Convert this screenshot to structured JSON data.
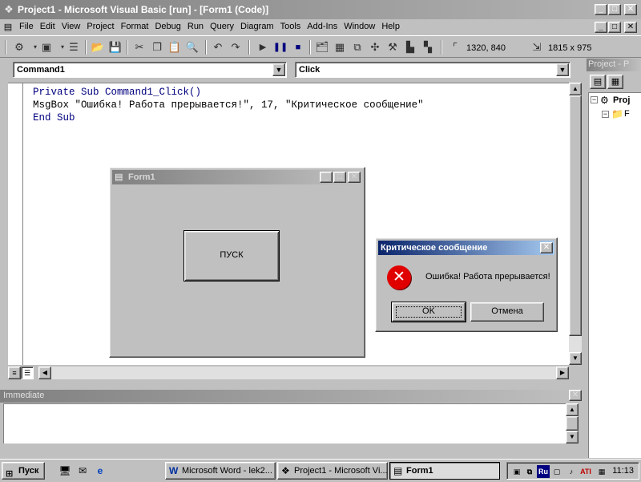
{
  "window": {
    "title": "Project1 - Microsoft Visual Basic [run] - [Form1 (Code)]",
    "min": "_",
    "max": "□",
    "close": "✕"
  },
  "menu": [
    "File",
    "Edit",
    "View",
    "Project",
    "Format",
    "Debug",
    "Run",
    "Query",
    "Diagram",
    "Tools",
    "Add-Ins",
    "Window",
    "Help"
  ],
  "toolbar": {
    "position": "1320, 840",
    "size": "1815 x 975"
  },
  "code": {
    "object_combo": "Command1",
    "procedure_combo": "Click",
    "lines": [
      "Private Sub Command1_Click()",
      "MsgBox \"Ошибка! Работа прерывается!\", 17, \"Критическое сообщение\"",
      "End Sub"
    ]
  },
  "form1": {
    "title": "Form1",
    "button_label": "ПУСК"
  },
  "msgbox": {
    "title": "Критическое сообщение",
    "message": "Ошибка! Работа прерывается!",
    "ok_label": "OK",
    "cancel_label": "Отмена"
  },
  "immediate": {
    "title": "Immediate"
  },
  "project_panel": {
    "title": "Project - P",
    "tree": [
      "Proj",
      "F",
      ""
    ]
  },
  "taskbar": {
    "start_label": "Пуск",
    "tasks": [
      "Microsoft Word - lek2...",
      "Project1 - Microsoft Vi...",
      "Form1"
    ],
    "language": "Ru",
    "clock": "11:13"
  },
  "colors": {
    "active_caption": "#0a246a",
    "inactive_caption": "#808080",
    "error_icon": "#e00000",
    "keyword": "#00007f"
  }
}
